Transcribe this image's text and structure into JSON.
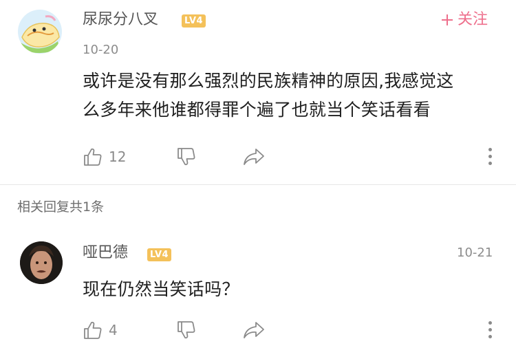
{
  "comment": {
    "username": "尿尿分八叉",
    "level": "LV4",
    "date": "10-20",
    "follow_label": "关注",
    "text_line1": "或许是没有那么强烈的民族精神的原因,我感觉这",
    "text_line2": "么多年来他谁都得罪个遍了也就当个笑话看看",
    "like_count": "12"
  },
  "replies_header": "相关回复共1条",
  "reply": {
    "username": "哑巴德",
    "level": "LV4",
    "date": "10-21",
    "text": "现在仍然当笑话吗？",
    "like_count": "4"
  },
  "icons": {
    "like": "thumbs-up-icon",
    "dislike": "thumbs-down-icon",
    "share": "share-arrow-icon",
    "more": "more-vertical-icon",
    "follow": "plus-icon"
  },
  "colors": {
    "level_badge": "#f4c15a",
    "follow": "#ee6f8c",
    "muted": "#8a8a8a"
  }
}
